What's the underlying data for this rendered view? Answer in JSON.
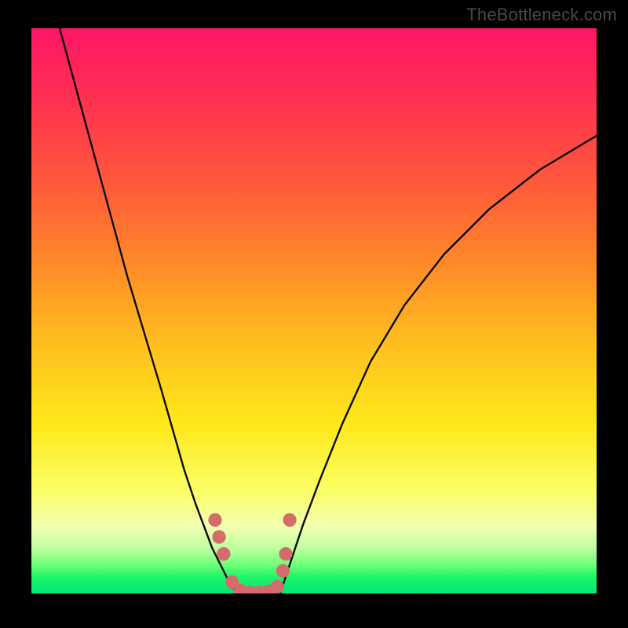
{
  "domain": "Chart",
  "source_watermark": "TheBottleneck.com",
  "chart_data": {
    "type": "line",
    "title": "",
    "xlabel": "",
    "ylabel": "",
    "xlim": [
      0,
      100
    ],
    "ylim": [
      0,
      100
    ],
    "background_gradient": {
      "direction": "top-to-bottom",
      "stops": [
        {
          "pos": 0,
          "color": "#ff1664"
        },
        {
          "pos": 10,
          "color": "#ff2a55"
        },
        {
          "pos": 28,
          "color": "#ff5b3a"
        },
        {
          "pos": 42,
          "color": "#ff8b28"
        },
        {
          "pos": 56,
          "color": "#ffbf1e"
        },
        {
          "pos": 70,
          "color": "#ffe81a"
        },
        {
          "pos": 82,
          "color": "#fbff66"
        },
        {
          "pos": 88,
          "color": "#f3ffb0"
        },
        {
          "pos": 92,
          "color": "#bfffa0"
        },
        {
          "pos": 95,
          "color": "#6bff78"
        },
        {
          "pos": 97,
          "color": "#21f56a"
        },
        {
          "pos": 100,
          "color": "#00e874"
        }
      ]
    },
    "series": [
      {
        "name": "left_curve",
        "x": [
          5,
          8,
          11,
          14,
          17,
          20,
          23,
          25,
          27,
          29,
          30.5,
          32,
          33.5,
          35,
          36.5
        ],
        "values": [
          100,
          89,
          78,
          67,
          56,
          46,
          36,
          29,
          22,
          16,
          12,
          8,
          5,
          2,
          0
        ]
      },
      {
        "name": "right_curve",
        "x": [
          44,
          46,
          48,
          51,
          55,
          60,
          66,
          73,
          81,
          90,
          100
        ],
        "values": [
          0,
          6,
          12,
          20,
          30,
          41,
          51,
          60,
          68,
          75,
          81
        ]
      },
      {
        "name": "floor_segment",
        "x": [
          36.5,
          44
        ],
        "values": [
          0,
          0
        ]
      }
    ],
    "markers": {
      "name": "highlight_dots",
      "color": "#d56c6c",
      "radius_pct": 1.2,
      "points": [
        {
          "x": 32.5,
          "y": 13.0
        },
        {
          "x": 33.2,
          "y": 10.0
        },
        {
          "x": 34.0,
          "y": 7.0
        },
        {
          "x": 35.5,
          "y": 2.0
        },
        {
          "x": 37.0,
          "y": 0.5
        },
        {
          "x": 38.7,
          "y": 0.2
        },
        {
          "x": 40.3,
          "y": 0.2
        },
        {
          "x": 42.0,
          "y": 0.4
        },
        {
          "x": 43.5,
          "y": 1.2
        },
        {
          "x": 44.5,
          "y": 4.0
        },
        {
          "x": 45.0,
          "y": 7.0
        },
        {
          "x": 45.7,
          "y": 13.0
        }
      ]
    }
  }
}
